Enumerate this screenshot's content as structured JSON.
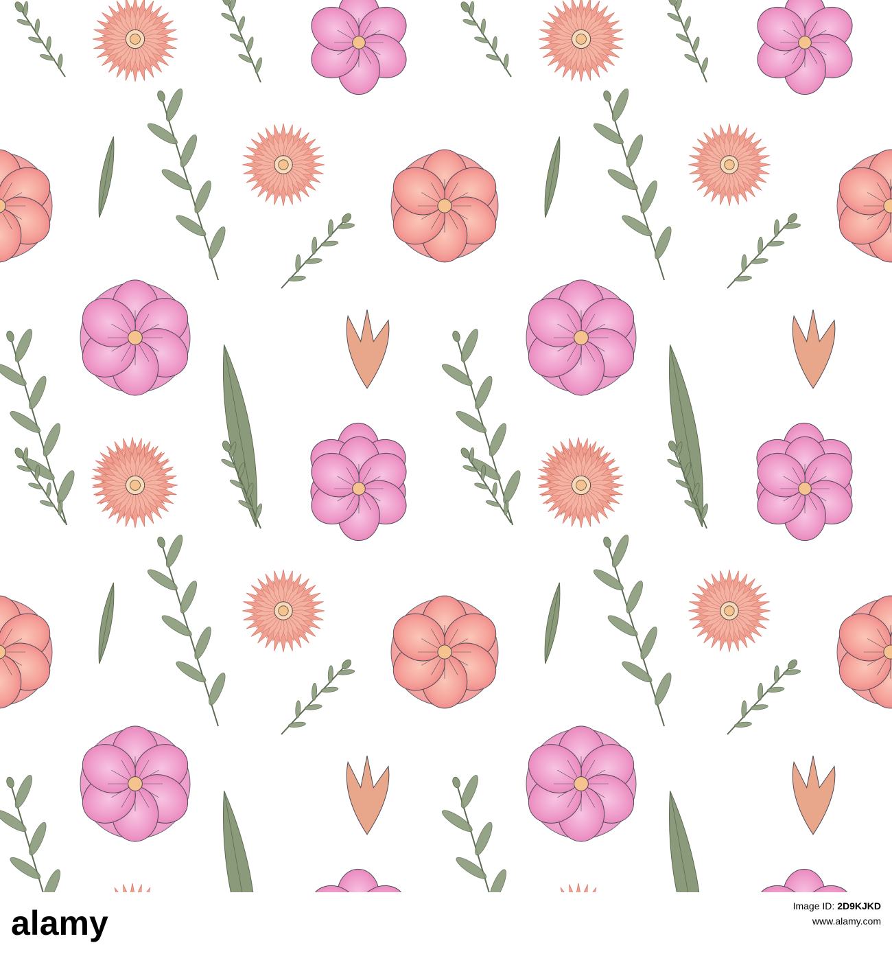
{
  "footer": {
    "logo_text": "alamy",
    "image_id_label": "Image ID:",
    "image_id": "2D9KJKD",
    "site": "www.alamy.com"
  },
  "colors": {
    "leaf": "#8a9a7a",
    "leaf_dark": "#5d6b52",
    "coral": "#f0a090",
    "coral_dark": "#d8786a",
    "pink": "#ee92c6",
    "pink_light": "#f5b3d8",
    "rose": "#f49a9a",
    "center": "#f6c28e",
    "outline": "#4e4a55"
  },
  "icons": [
    "coral-daisy-icon",
    "pink-flower-icon",
    "rose-flower-icon",
    "leaf-sprig-icon",
    "single-leaf-icon",
    "bud-icon"
  ]
}
